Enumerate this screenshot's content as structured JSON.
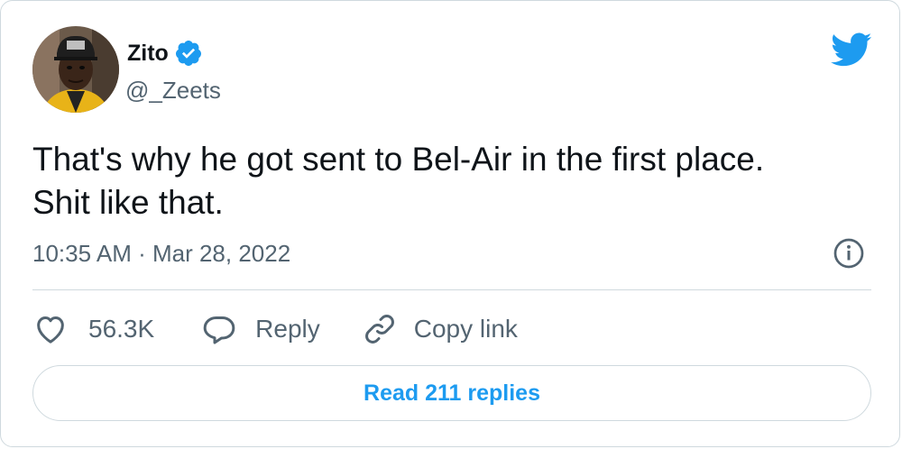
{
  "author": {
    "name": "Zito",
    "handle": "@_Zeets",
    "verified": true
  },
  "tweet": {
    "text_line1": "That's why he got sent to Bel-Air in the first place.",
    "text_line2": "Shit like that.",
    "timestamp": "10:35 AM · Mar 28, 2022"
  },
  "actions": {
    "like_count": "56.3K",
    "reply_label": "Reply",
    "copy_link_label": "Copy link"
  },
  "read_replies_label": "Read 211 replies",
  "colors": {
    "brand_blue": "#1d9bf0",
    "text_primary": "#0f1419",
    "text_secondary": "#536471",
    "border": "#cfd9de"
  },
  "icons": [
    "verified-badge-icon",
    "twitter-bird-icon",
    "info-icon",
    "heart-icon",
    "reply-bubble-icon",
    "link-icon"
  ]
}
